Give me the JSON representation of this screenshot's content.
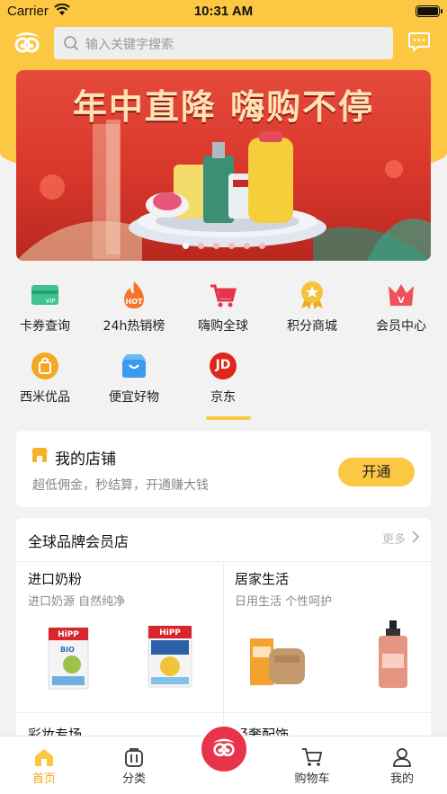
{
  "status_bar": {
    "carrier": "Carrier",
    "time": "10:31 AM"
  },
  "header": {
    "search_placeholder": "输入关键字搜索"
  },
  "banner": {
    "title": "年中直降 嗨购不停",
    "dots": 6,
    "active_dot": 0
  },
  "grid": [
    {
      "label": "卡券查询",
      "icon": "coupon-card-icon"
    },
    {
      "label": "24h热销榜",
      "icon": "hot-icon"
    },
    {
      "label": "嗨购全球",
      "icon": "cart-icon"
    },
    {
      "label": "积分商城",
      "icon": "medal-icon"
    },
    {
      "label": "会员中心",
      "icon": "vip-icon"
    },
    {
      "label": "西米优品",
      "icon": "bag-icon"
    },
    {
      "label": "便宜好物",
      "icon": "basket-icon"
    },
    {
      "label": "京东",
      "icon": "jd-icon",
      "badge": "JD"
    }
  ],
  "shop": {
    "title": "我的店铺",
    "subtitle": "超低佣金，秒结算，开通赚大钱",
    "button": "开通"
  },
  "brand_section": {
    "title": "全球品牌会员店",
    "more": "更多",
    "categories": [
      {
        "title": "进口奶粉",
        "subtitle": "进口奶源  自然纯净",
        "products": [
          "HiPP BIO",
          "HiPP Kindermilch"
        ]
      },
      {
        "title": "居家生活",
        "subtitle": "日用生活  个性呵护",
        "products": []
      },
      {
        "title": "彩妆专场"
      },
      {
        "title": "轻奢配饰"
      }
    ]
  },
  "tabbar": {
    "tabs": [
      {
        "label": "首页",
        "active": true
      },
      {
        "label": "分类",
        "active": false
      },
      {
        "label": "购物车",
        "active": false
      },
      {
        "label": "我的",
        "active": false
      }
    ]
  },
  "colors": {
    "accent": "#fcc742",
    "tab_active": "#f2a41c",
    "center": "#e8344a"
  }
}
